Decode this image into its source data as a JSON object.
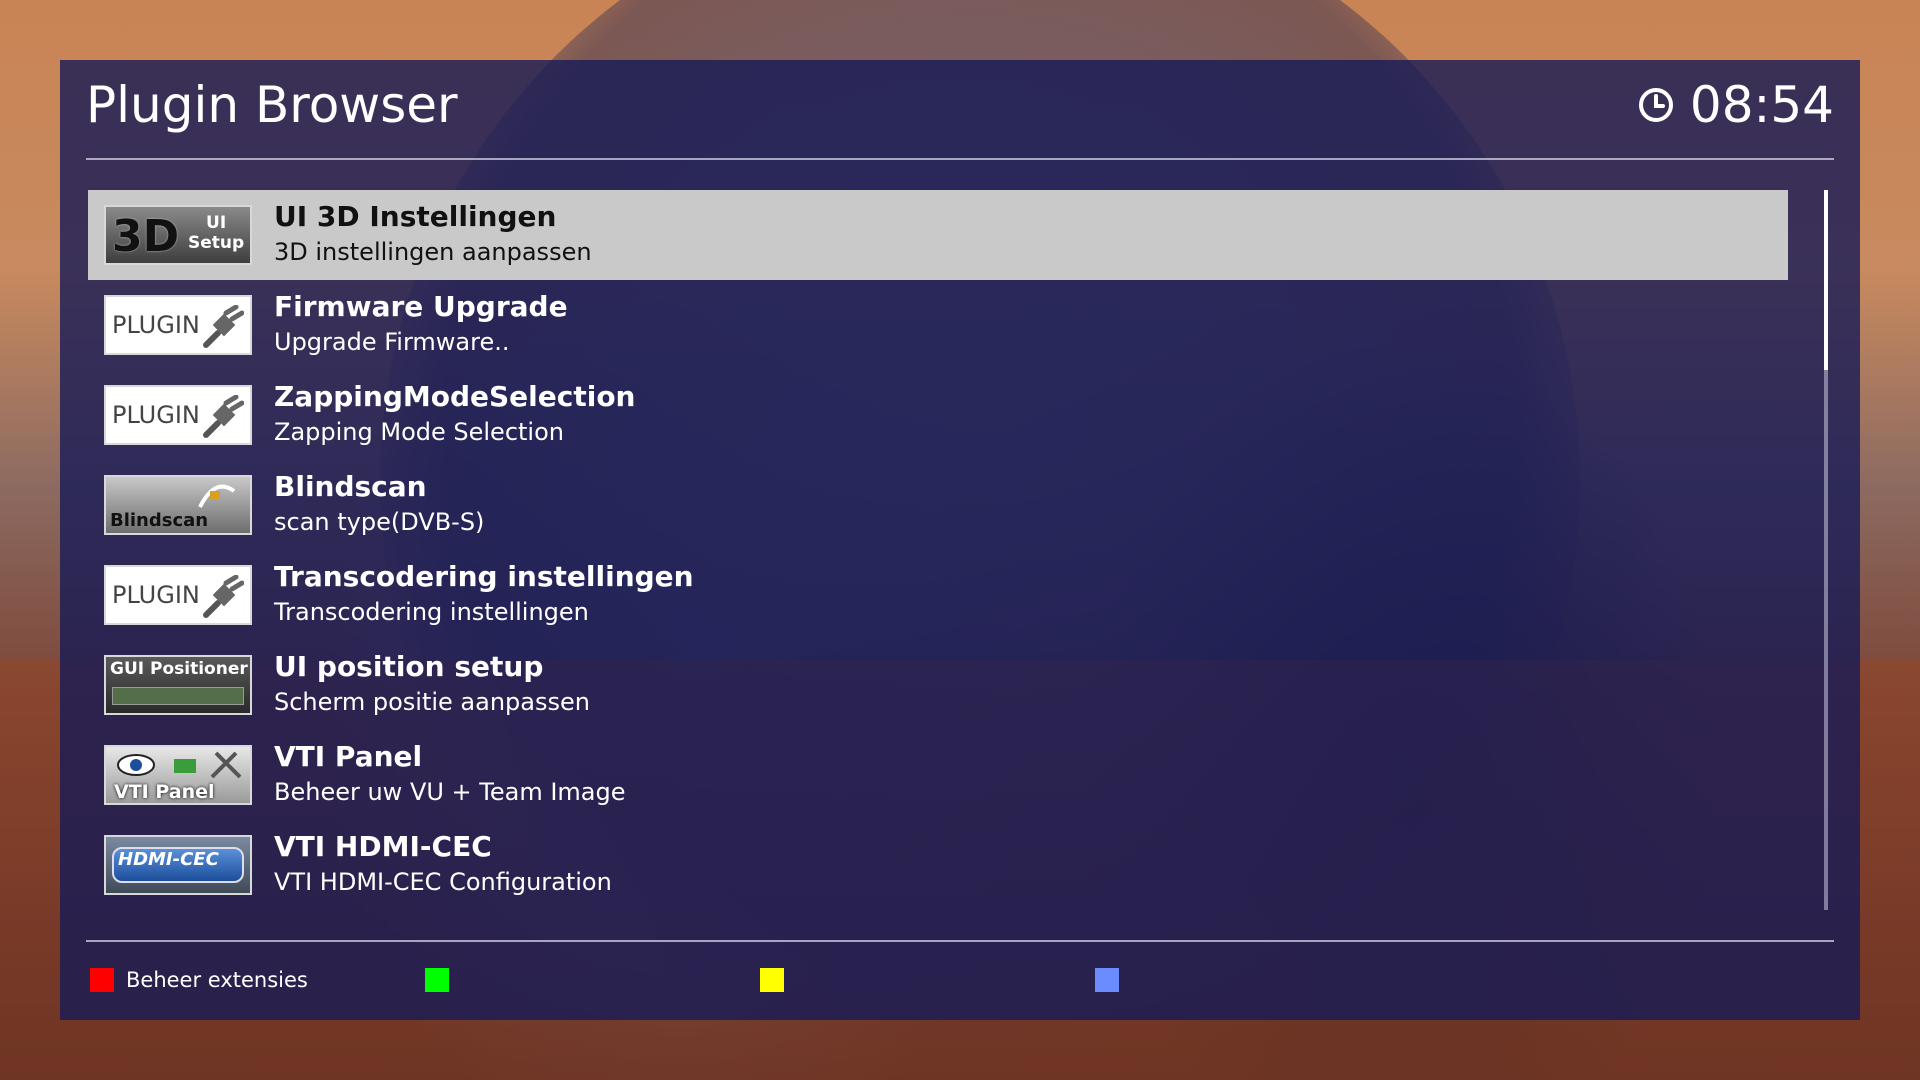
{
  "window": {
    "title": "Plugin Browser",
    "clock": "08:54"
  },
  "plugins": [
    {
      "name": "UI 3D Instellingen",
      "description": "3D instellingen aanpassen",
      "icon": "3d-ui-setup-icon",
      "icon_text": [
        "3D",
        "UI",
        "Setup"
      ],
      "selected": true
    },
    {
      "name": "Firmware Upgrade",
      "description": "Upgrade Firmware..",
      "icon": "plugin-icon",
      "icon_text": [
        "PLUGIN"
      ],
      "selected": false
    },
    {
      "name": "ZappingModeSelection",
      "description": "Zapping Mode Selection",
      "icon": "plugin-icon",
      "icon_text": [
        "PLUGIN"
      ],
      "selected": false
    },
    {
      "name": "Blindscan",
      "description": "scan type(DVB-S)",
      "icon": "blindscan-icon",
      "icon_text": [
        "Blindscan"
      ],
      "selected": false
    },
    {
      "name": "Transcodering instellingen",
      "description": "Transcodering instellingen",
      "icon": "plugin-icon",
      "icon_text": [
        "PLUGIN"
      ],
      "selected": false
    },
    {
      "name": "UI position setup",
      "description": "Scherm positie aanpassen",
      "icon": "gui-positioner-icon",
      "icon_text": [
        "GUI Positioner"
      ],
      "selected": false
    },
    {
      "name": "VTI Panel",
      "description": "Beheer uw VU + Team Image",
      "icon": "vti-panel-icon",
      "icon_text": [
        "VTI Panel"
      ],
      "selected": false
    },
    {
      "name": "VTI HDMI-CEC",
      "description": "VTI HDMI-CEC Configuration",
      "icon": "hdmi-cec-icon",
      "icon_text": [
        "HDMI-CEC"
      ],
      "selected": false
    }
  ],
  "scrollbar": {
    "thumb_fraction": 0.25
  },
  "footer": {
    "keys": [
      {
        "color": "#ff0000",
        "label": "Beheer extensies",
        "name": "red-key"
      },
      {
        "color": "#00ff00",
        "label": "",
        "name": "green-key"
      },
      {
        "color": "#ffff00",
        "label": "",
        "name": "yellow-key"
      },
      {
        "color": "#6a8cff",
        "label": "",
        "name": "blue-key"
      }
    ]
  },
  "colors": {
    "panel": "#161a56",
    "selection": "#c9c9c9"
  }
}
